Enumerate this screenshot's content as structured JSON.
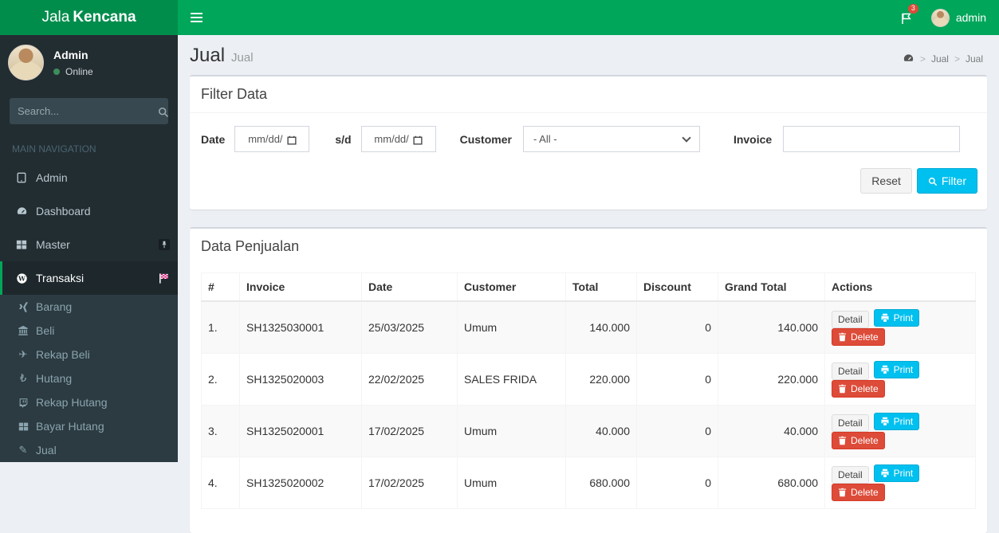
{
  "brand": {
    "name_light": "Jala",
    "name_bold": "Kencana"
  },
  "navbar": {
    "username": "admin",
    "notification_count": "3"
  },
  "sidebar": {
    "user": {
      "name": "Admin",
      "status": "Online"
    },
    "search_placeholder": "Search...",
    "section_label": "MAIN NAVIGATION",
    "menu": [
      {
        "label": "Admin",
        "icon": "tablet-icon"
      },
      {
        "label": "Dashboard",
        "icon": "dashboard-icon"
      },
      {
        "label": "Master",
        "icon": "th-large-icon",
        "badge": "pin-icon"
      },
      {
        "label": "Transaksi",
        "icon": "wordpress-icon",
        "badge": "flag-checkered-icon",
        "active": true,
        "children": [
          {
            "label": "Barang",
            "icon": "xing-icon"
          },
          {
            "label": "Beli",
            "icon": "bank-icon"
          },
          {
            "label": "Rekap Beli",
            "icon": "plane-icon"
          },
          {
            "label": "Hutang",
            "icon": "lira-icon"
          },
          {
            "label": "Rekap Hutang",
            "icon": "twitch-icon"
          },
          {
            "label": "Bayar Hutang",
            "icon": "windows-icon"
          },
          {
            "label": "Jual",
            "icon": "pencil-icon"
          }
        ]
      }
    ]
  },
  "content": {
    "page_title": "Jual",
    "page_subtitle": "Jual",
    "breadcrumb": {
      "separator": ">",
      "items": [
        "Jual",
        "Jual"
      ]
    },
    "filter": {
      "title": "Filter Data",
      "date_label": "Date",
      "date_display": "mm/dd/",
      "sd_label": "s/d",
      "customer_label": "Customer",
      "customer_value": "- All -",
      "invoice_label": "Invoice",
      "invoice_value": "",
      "reset_label": "Reset",
      "filter_label": "Filter"
    },
    "table": {
      "title": "Data Penjualan",
      "headers": [
        "#",
        "Invoice",
        "Date",
        "Customer",
        "Total",
        "Discount",
        "Grand Total",
        "Actions"
      ],
      "actions": {
        "detail": "Detail",
        "print": "Print",
        "delete": "Delete"
      },
      "rows": [
        {
          "no": "1.",
          "invoice": "SH1325030001",
          "date": "25/03/2025",
          "customer": "Umum",
          "total": "140.000",
          "discount": "0",
          "grand_total": "140.000"
        },
        {
          "no": "2.",
          "invoice": "SH1325020003",
          "date": "22/02/2025",
          "customer": "SALES FRIDA",
          "total": "220.000",
          "discount": "0",
          "grand_total": "220.000"
        },
        {
          "no": "3.",
          "invoice": "SH1325020001",
          "date": "17/02/2025",
          "customer": "Umum",
          "total": "40.000",
          "discount": "0",
          "grand_total": "40.000"
        },
        {
          "no": "4.",
          "invoice": "SH1325020002",
          "date": "17/02/2025",
          "customer": "Umum",
          "total": "680.000",
          "discount": "0",
          "grand_total": "680.000"
        }
      ]
    }
  },
  "colors": {
    "navbar_green": "#00a65a",
    "logo_green": "#008d4c",
    "sidebar_dark": "#222d32",
    "info_cyan": "#00c0ef",
    "danger_red": "#dd4b39",
    "online_green": "#3c8e5c",
    "content_bg": "#ecf0f5"
  }
}
